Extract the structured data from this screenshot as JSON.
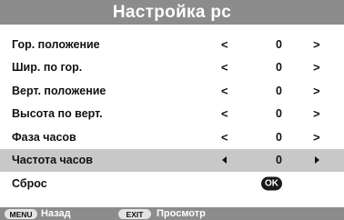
{
  "title": "Настройка pc",
  "rows": [
    {
      "label": "Гор. положение",
      "left": "<",
      "value": "0",
      "right": ">"
    },
    {
      "label": "Шир. по гор.",
      "left": "<",
      "value": "0",
      "right": ">"
    },
    {
      "label": "Верт. положение",
      "left": "<",
      "value": "0",
      "right": ">"
    },
    {
      "label": "Высота по верт.",
      "left": "<",
      "value": "0",
      "right": ">"
    },
    {
      "label": "Фаза часов",
      "left": "<",
      "value": "0",
      "right": ">"
    },
    {
      "label": "Частота часов",
      "value": "0"
    },
    {
      "label": "Сброс",
      "ok_label": "OK"
    }
  ],
  "selected_index": 5,
  "footer": {
    "menu_key": "MENU",
    "menu_hint": "Назад",
    "exit_key": "EXIT",
    "exit_hint": "Просмотр"
  },
  "colors": {
    "bar": "#8c8c8c",
    "selected_row": "#c8c8c8",
    "ok_badge": "#1a1a1a"
  }
}
